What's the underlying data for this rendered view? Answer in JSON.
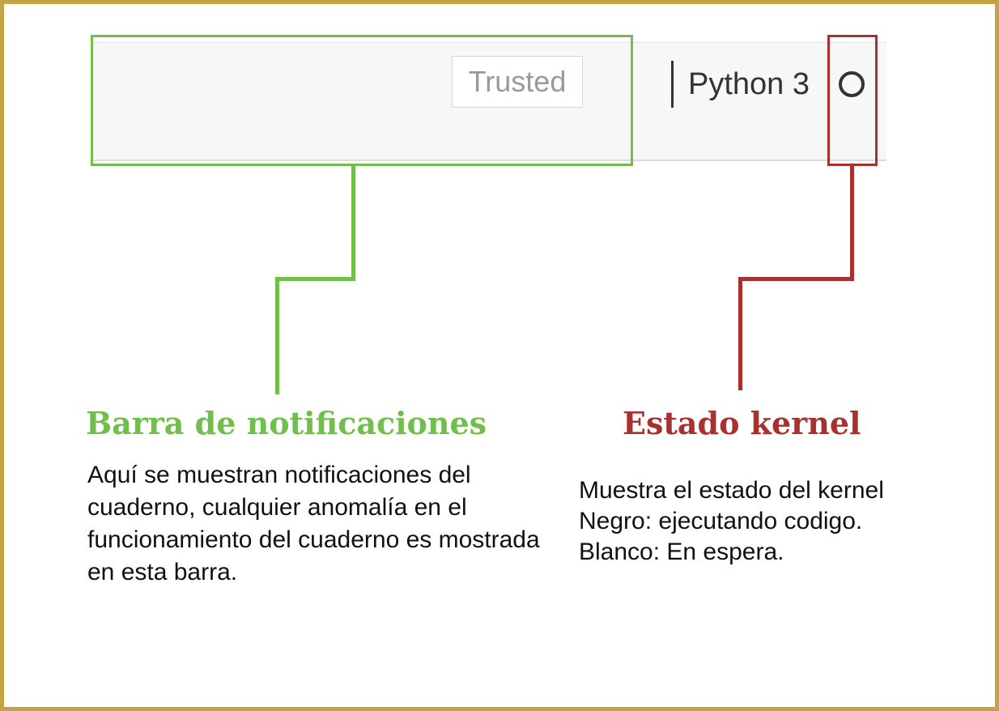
{
  "header": {
    "trusted_label": "Trusted",
    "kernel_name": "Python 3",
    "kernel_status_icon": "circle-outline-icon"
  },
  "annotations": {
    "notification_bar": {
      "title": "Barra de notificaciones",
      "description": "Aquí se muestran notificaciones del cuaderno, cualquier anomalía en el funcionamiento del cuaderno es mostrada en esta barra.",
      "color": "#6fbf4a"
    },
    "kernel_status": {
      "title": "Estado kernel",
      "lines": [
        "Muestra el estado del kernel",
        "Negro: ejecutando codigo.",
        "Blanco: En espera."
      ],
      "color": "#a8312f"
    }
  },
  "colors": {
    "frame_border": "#c2a444",
    "header_background": "#f7f7f7"
  }
}
